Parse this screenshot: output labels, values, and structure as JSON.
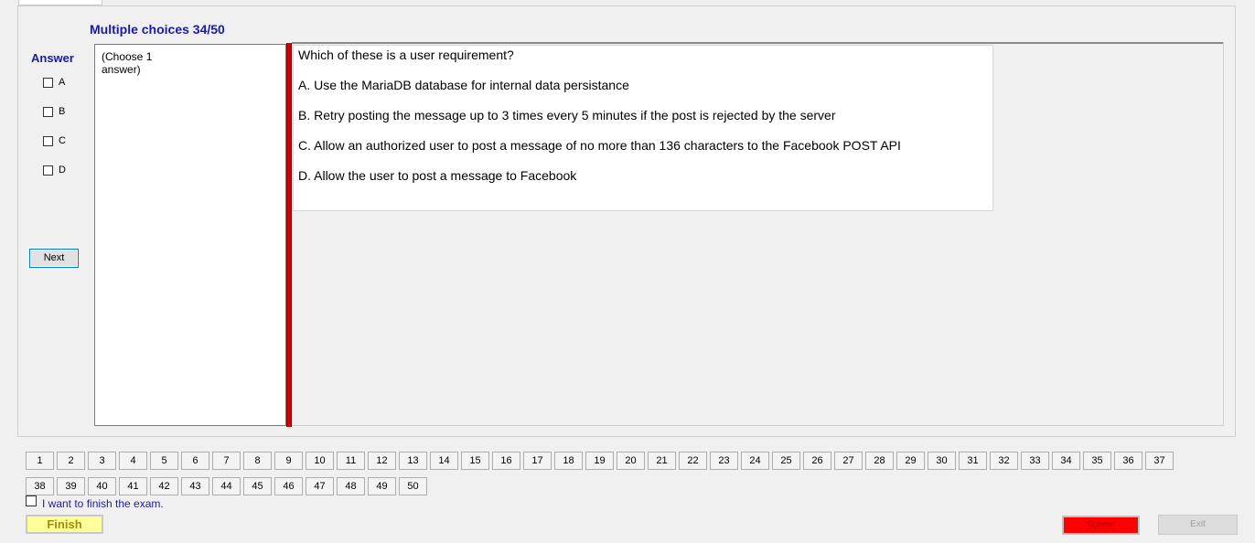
{
  "header": {
    "title": "Multiple choices 34/50"
  },
  "answer_panel": {
    "label": "Answer",
    "options": [
      "A",
      "B",
      "C",
      "D"
    ],
    "next_label": "Next"
  },
  "instructions": {
    "text": "(Choose 1\nanswer)"
  },
  "question": {
    "text": "Which of these is a user requirement?",
    "answers": [
      "A.  Use the MariaDB database for internal data persistance",
      "B.  Retry posting the message up to 3 times every 5 minutes if the post is rejected by the server",
      "C.  Allow an authorized user to post a message of no more than 136 characters to the Facebook POST API",
      "D.  Allow the user to post a message to Facebook"
    ]
  },
  "navigator": {
    "row1": [
      "1",
      "2",
      "3",
      "4",
      "5",
      "6",
      "7",
      "8",
      "9",
      "10",
      "11",
      "12",
      "13",
      "14",
      "15",
      "16",
      "17",
      "18",
      "19",
      "20",
      "21",
      "22",
      "23",
      "24",
      "25",
      "26",
      "27",
      "28",
      "29",
      "30",
      "31",
      "32",
      "33",
      "34",
      "35",
      "36",
      "37"
    ],
    "row2": [
      "38",
      "39",
      "40",
      "41",
      "42",
      "43",
      "44",
      "45",
      "46",
      "47",
      "48",
      "49",
      "50"
    ]
  },
  "footer": {
    "finish_check_label": "I want to finish the exam.",
    "finish_label": "Finish",
    "submit_label": "Submit",
    "exit_label": "Exit"
  },
  "colors": {
    "accent_blue": "#1a1aa6",
    "red_bar": "#d40000",
    "finish_bg": "#ffff99",
    "submit_bg": "#ff0000"
  }
}
